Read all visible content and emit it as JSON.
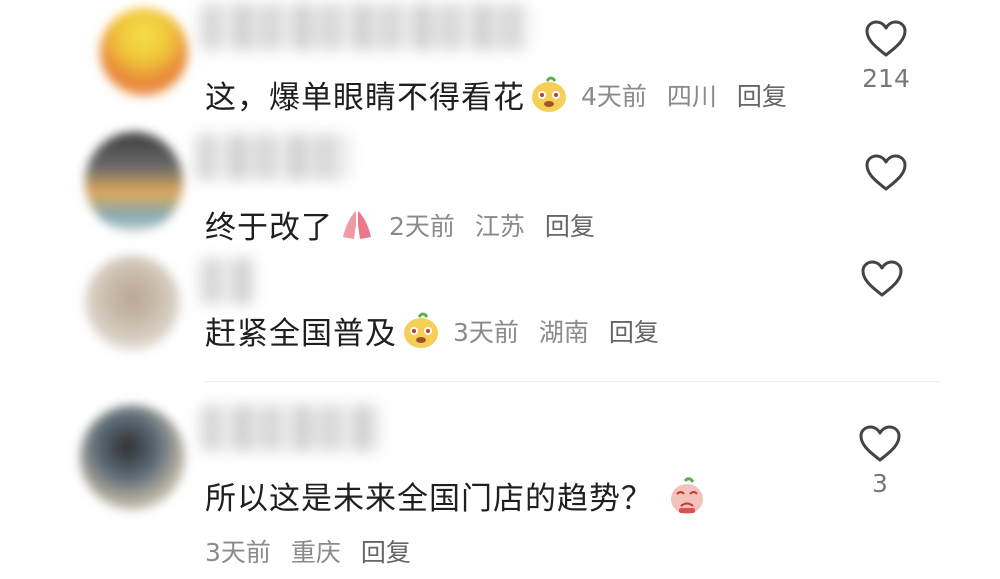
{
  "comments": [
    {
      "text": "这，爆单眼睛不得看花",
      "emoji": "doge-emoji",
      "time": "4天前",
      "location": "四川",
      "reply_label": "回复",
      "likes": "214"
    },
    {
      "text": "终于改了",
      "emoji": "pray-emoji",
      "time": "2天前",
      "location": "江苏",
      "reply_label": "回复",
      "likes": ""
    },
    {
      "text": "赶紧全国普及",
      "emoji": "doge-emoji",
      "time": "3天前",
      "location": "湖南",
      "reply_label": "回复",
      "likes": ""
    },
    {
      "text": "所以这是未来全国门店的趋势？",
      "emoji": "pleading-emoji",
      "time": "3天前",
      "location": "重庆",
      "reply_label": "回复",
      "likes": "3"
    }
  ],
  "colors": {
    "text": "#1f1f1f",
    "meta": "#8a8a8a",
    "icon": "#444444"
  }
}
